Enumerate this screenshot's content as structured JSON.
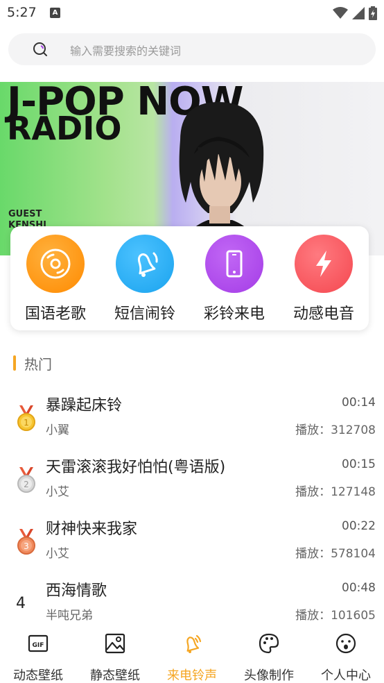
{
  "status_bar": {
    "time": "5:27",
    "notification_icon": "A"
  },
  "search": {
    "placeholder": "输入需要搜索的关键词"
  },
  "banner": {
    "line1": "J-POP NOW",
    "line2": "RADIO",
    "guest_label": "GUEST",
    "guest_name": "KENSHI"
  },
  "categories": [
    {
      "label": "国语老歌",
      "icon": "disc-icon",
      "color": "#ff8a00"
    },
    {
      "label": "短信闹铃",
      "icon": "bell-icon",
      "color": "#1aa3ee"
    },
    {
      "label": "彩铃来电",
      "icon": "phone-icon",
      "color": "#a43ce6"
    },
    {
      "label": "动感电音",
      "icon": "lightning-icon",
      "color": "#f4474f"
    }
  ],
  "section": {
    "title": "热门"
  },
  "songs": [
    {
      "rank": "1",
      "title": "暴躁起床铃",
      "artist": "小翼",
      "duration": "00:14",
      "plays": "播放：312708"
    },
    {
      "rank": "2",
      "title": "天雷滚滚我好怕怕(粤语版)",
      "artist": "小艾",
      "duration": "00:15",
      "plays": "播放：127148"
    },
    {
      "rank": "3",
      "title": "财神快来我家",
      "artist": "小艾",
      "duration": "00:22",
      "plays": "播放：578104"
    },
    {
      "rank": "4",
      "title": "西海情歌",
      "artist": "半吨兄弟",
      "duration": "00:48",
      "plays": "播放：101605"
    }
  ],
  "bottom_nav": [
    {
      "label": "动态壁纸",
      "icon": "gif-icon",
      "active": false
    },
    {
      "label": "静态壁纸",
      "icon": "image-icon",
      "active": false
    },
    {
      "label": "来电铃声",
      "icon": "ringing-bell-icon",
      "active": true
    },
    {
      "label": "头像制作",
      "icon": "palette-icon",
      "active": false
    },
    {
      "label": "个人中心",
      "icon": "face-icon",
      "active": false
    }
  ],
  "colors": {
    "accent": "#f5a623",
    "search_bg": "#f4f4f5"
  }
}
